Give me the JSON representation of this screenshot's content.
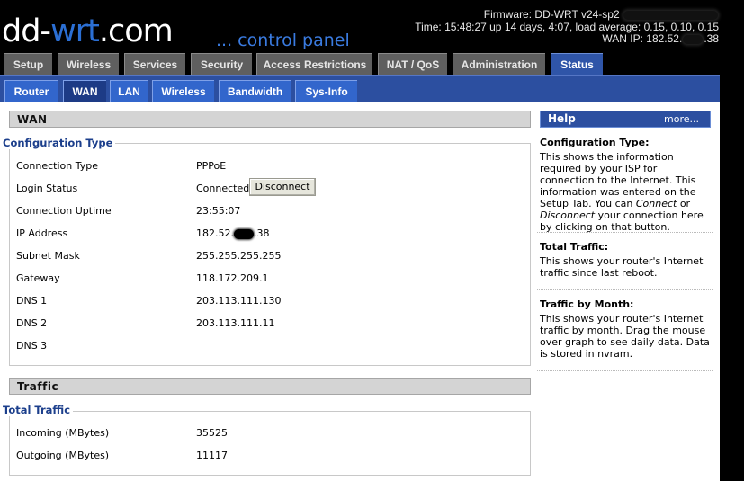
{
  "header": {
    "logo_white": "dd-",
    "logo_blue": "wrt",
    "logo_white2": ".com",
    "control_panel": "... control panel",
    "firmware": "Firmware: DD-WRT v24-sp2",
    "time": "Time: 15:48:27 up 14 days, 4:07, load average: 0.15, 0.10, 0.15",
    "wan_ip_prefix": "WAN IP: 182.52.",
    "wan_ip_suffix": ".38"
  },
  "main_tabs": [
    "Setup",
    "Wireless",
    "Services",
    "Security",
    "Access Restrictions",
    "NAT / QoS",
    "Administration",
    "Status"
  ],
  "sub_tabs": [
    "Router",
    "WAN",
    "LAN",
    "Wireless",
    "Bandwidth",
    "Sys-Info"
  ],
  "wan": {
    "section_title": "WAN",
    "config_legend": "Configuration Type",
    "rows": [
      {
        "label": "Connection Type",
        "value": "PPPoE"
      },
      {
        "label": "Login Status",
        "value": "Connected"
      },
      {
        "label": "Connection Uptime",
        "value": "23:55:07"
      },
      {
        "label": "IP Address",
        "value_prefix": "182.52.",
        "value_suffix": ".38"
      },
      {
        "label": "Subnet Mask",
        "value": "255.255.255.255"
      },
      {
        "label": "Gateway",
        "value": "118.172.209.1"
      },
      {
        "label": "DNS 1",
        "value": "203.113.111.130"
      },
      {
        "label": "DNS 2",
        "value": "203.113.111.11"
      },
      {
        "label": "DNS 3",
        "value": ""
      }
    ],
    "disconnect_label": "Disconnect"
  },
  "traffic": {
    "section_title": "Traffic",
    "legend": "Total Traffic",
    "rows": [
      {
        "label": "Incoming (MBytes)",
        "value": "35525"
      },
      {
        "label": "Outgoing (MBytes)",
        "value": "11117"
      }
    ]
  },
  "help": {
    "title": "Help",
    "more": "more...",
    "sections": [
      {
        "heading": "Configuration Type:",
        "text_1": "This shows the information required by your ISP for connection to the Internet. This information was entered on the Setup Tab. You can ",
        "em_1": "Connect",
        "text_2": " or ",
        "em_2": "Disconnect",
        "text_3": " your connection here by clicking on that button."
      },
      {
        "heading": "Total Traffic:",
        "text": "This shows your router's Internet traffic since last reboot."
      },
      {
        "heading": "Traffic by Month:",
        "text": "This shows your router's Internet traffic by month. Drag the mouse over graph to see daily data. Data is stored in nvram."
      }
    ]
  },
  "colors": {
    "status_tab": "#2f55a8",
    "sub_bar": "#2c4fa0",
    "legend_blue": "#1c3f8c"
  }
}
